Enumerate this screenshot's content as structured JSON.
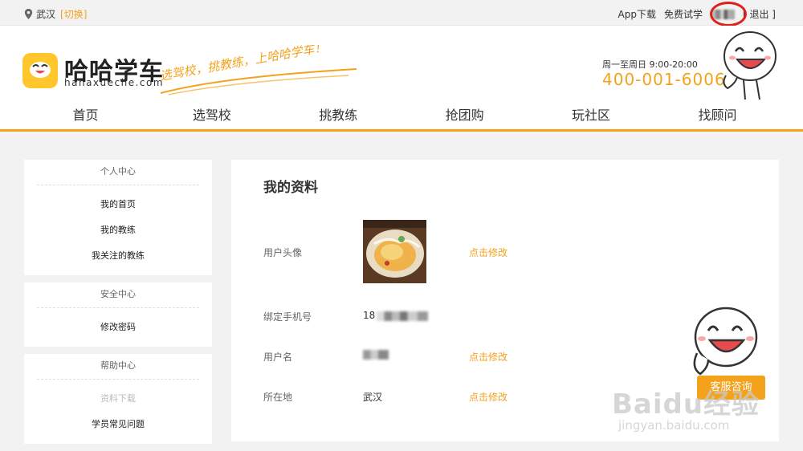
{
  "topbar": {
    "city": "武汉",
    "switch_label": "[切换]",
    "app_download": "App下载",
    "free_trial": "免费试学",
    "logout": "[ 退出 ]"
  },
  "header": {
    "logo_title": "哈哈学车",
    "logo_url": "hahaxueche.com",
    "slogan": "选驾校，挑教练，上哈哈学车！",
    "hours": "周一至周日 9:00-20:00",
    "phone": "400-001-6006"
  },
  "nav": {
    "items": [
      "首页",
      "选驾校",
      "挑教练",
      "抢团购",
      "玩社区",
      "找顾问"
    ]
  },
  "sidebar": {
    "personal": {
      "heading": "个人中心",
      "items": [
        "我的首页",
        "我的教练",
        "我关注的教练"
      ]
    },
    "security": {
      "heading": "安全中心",
      "items": [
        "修改密码"
      ]
    },
    "help": {
      "heading": "帮助中心",
      "items": [
        "资料下载",
        "学员常见问题"
      ]
    }
  },
  "profile": {
    "title": "我的资料",
    "avatar_label": "用户头像",
    "phone_label": "绑定手机号",
    "phone_prefix": "18",
    "username_label": "用户名",
    "location_label": "所在地",
    "location_value": "武汉",
    "edit_label": "点击修改"
  },
  "widget": {
    "customer_service": "客服咨询"
  },
  "watermark": {
    "brand": "Baidu经验",
    "url": "jingyan.baidu.com"
  },
  "colors": {
    "accent": "#f4a21c",
    "highlight": "#e0201b"
  }
}
